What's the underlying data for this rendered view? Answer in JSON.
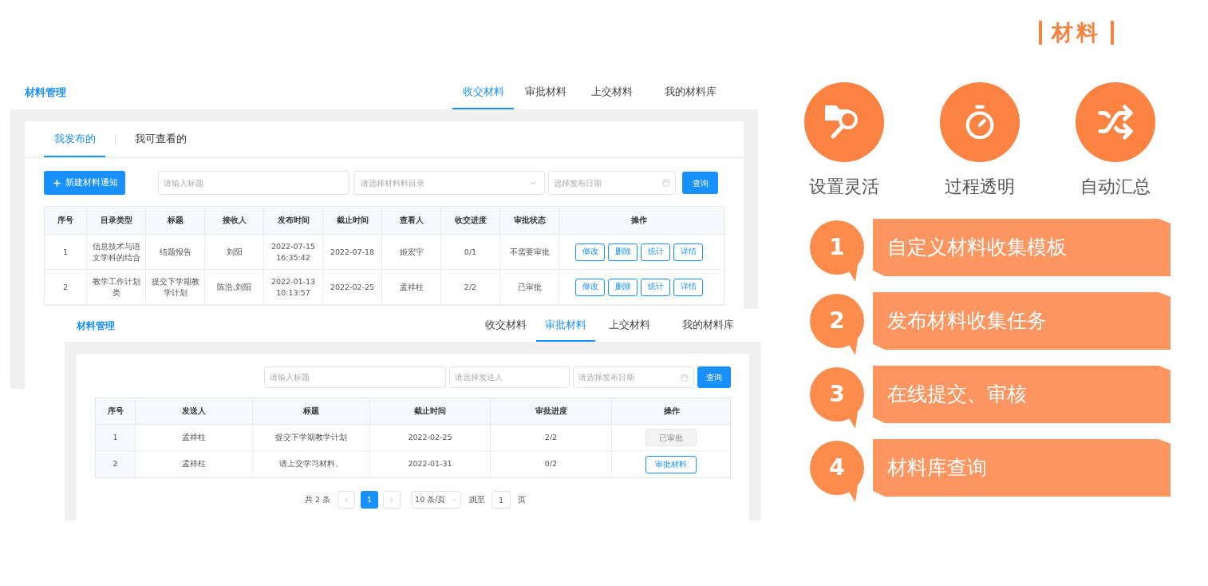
{
  "back_window": {
    "app_title": "材料管理",
    "nav_tabs": [
      {
        "label": "收交材料",
        "selected": true
      },
      {
        "label": "审批材料",
        "selected": false
      },
      {
        "label": "上交材料",
        "selected": false
      },
      {
        "label": "我的材料库",
        "selected": false
      }
    ],
    "sub_tabs": [
      {
        "label": "我发布的",
        "selected": true
      },
      {
        "label": "我可查看的",
        "selected": false
      }
    ],
    "new_button": "新建材料通知",
    "filters": {
      "title_placeholder": "请输入标题",
      "catalog_placeholder": "请选择材料料目录",
      "date_placeholder": "选择发布日期"
    },
    "query_button": "查询",
    "table": {
      "columns": [
        "序号",
        "目录类型",
        "标题",
        "接收人",
        "发布时间",
        "截止时间",
        "查看人",
        "收交进度",
        "审批状态",
        "操作"
      ],
      "rows": [
        {
          "cells": [
            "1",
            "信息技术与语文学科的结合",
            "结题报告",
            "刘阳",
            "2022-07-15 16:35:42",
            "2022-07-18",
            "姬宏宇",
            "0/1",
            "不需要审批"
          ],
          "actions": [
            "修改",
            "删除",
            "统计",
            "详情"
          ]
        },
        {
          "cells": [
            "2",
            "教学工作计划类",
            "提交下学期教学计划",
            "陈浩,刘阳",
            "2022-01-13 10:13:57",
            "2022-02-25",
            "孟祥柱",
            "2/2",
            "已审批"
          ],
          "actions": [
            "修改",
            "删除",
            "统计",
            "详情"
          ]
        }
      ]
    }
  },
  "front_window": {
    "app_title": "材料管理",
    "nav_tabs": [
      {
        "label": "收交材料",
        "selected": false
      },
      {
        "label": "审批材料",
        "selected": true
      },
      {
        "label": "上交材料",
        "selected": false
      },
      {
        "label": "我的材料库",
        "selected": false
      }
    ],
    "filters": {
      "title_placeholder": "请输入标题",
      "sender_placeholder": "请选择发送人",
      "date_placeholder": "请选择发布日期"
    },
    "query_button": "查询",
    "table": {
      "columns": [
        "序号",
        "发送人",
        "标题",
        "截止时间",
        "审批进度",
        "操作"
      ],
      "rows": [
        {
          "cells": [
            "1",
            "孟祥柱",
            "提交下学期教学计划",
            "2022-02-25",
            "2/2"
          ],
          "action": {
            "label": "已审批",
            "disabled": true
          }
        },
        {
          "cells": [
            "2",
            "孟祥柱",
            "请上交学习材料。",
            "2022-01-31",
            "0/2"
          ],
          "action": {
            "label": "审批材料",
            "disabled": false
          }
        }
      ]
    },
    "pagination": {
      "total": "共 2 条",
      "pages": [
        {
          "label": "1",
          "selected": true
        }
      ],
      "page_size": "10 条/页",
      "jump_label": "跳至",
      "jump_value": "1",
      "page_unit": "页"
    }
  },
  "slide": {
    "title": "材料",
    "features": [
      {
        "kind": "folder-search",
        "label": "设置灵活"
      },
      {
        "kind": "stopwatch",
        "label": "过程透明"
      },
      {
        "kind": "shuffle",
        "label": "自动汇总"
      }
    ],
    "steps": [
      {
        "number": "1",
        "text": "自定义材料收集模板"
      },
      {
        "number": "2",
        "text": "发布材料收集任务"
      },
      {
        "number": "3",
        "text": "在线提交、审核"
      },
      {
        "number": "4",
        "text": "材料库查询"
      }
    ]
  }
}
